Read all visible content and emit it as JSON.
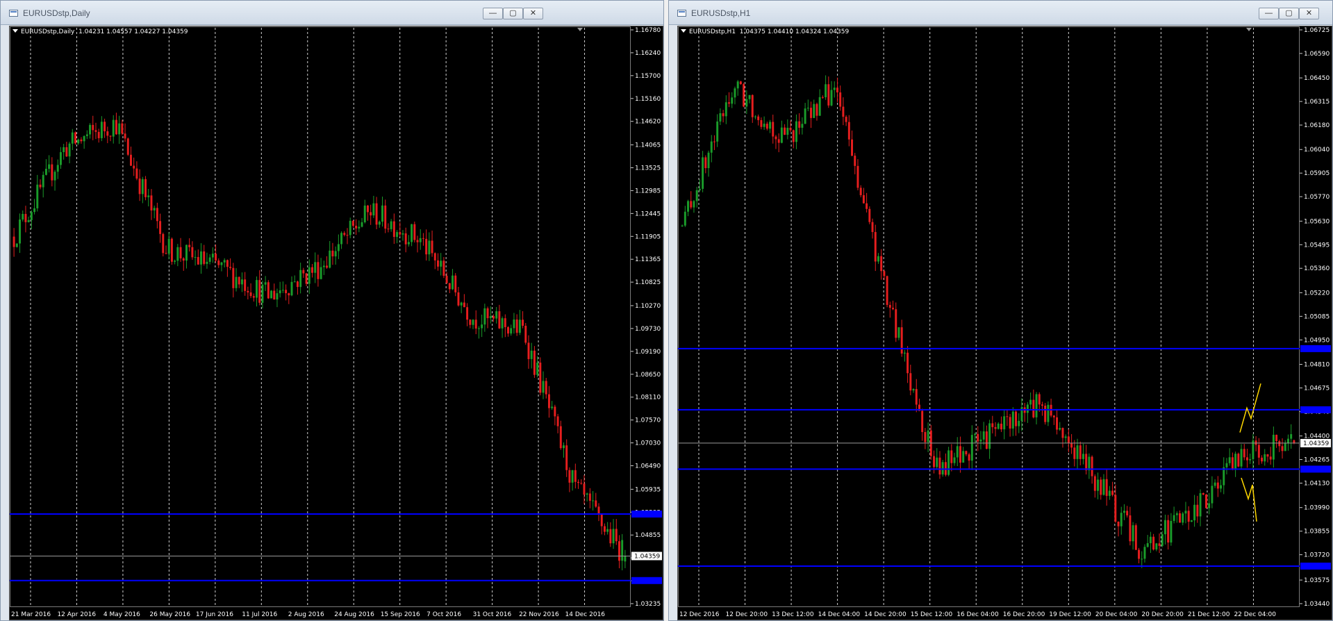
{
  "windows": [
    {
      "id": "daily",
      "title": "EURUSDstp,Daily",
      "symbol": "EURUSDstp,Daily",
      "ohlc": "1.04231 1.04557 1.04227 1.04359",
      "controls": {
        "minimize": "—",
        "maximize": "▢",
        "close": "✕"
      },
      "price_axis": [
        "1.16780",
        "1.16240",
        "1.15700",
        "1.15160",
        "1.14620",
        "1.14065",
        "1.13525",
        "1.12985",
        "1.12445",
        "1.11905",
        "1.11365",
        "1.10825",
        "1.10270",
        "1.09730",
        "1.09190",
        "1.08650",
        "1.08110",
        "1.07570",
        "1.07030",
        "1.06490",
        "1.05935",
        "1.05395",
        "1.04855",
        "1.04315",
        "1.03775",
        "1.03235"
      ],
      "time_axis": [
        "21 Mar 2016",
        "12 Apr 2016",
        "4 May 2016",
        "26 May 2016",
        "17 Jun 2016",
        "11 Jul 2016",
        "2 Aug 2016",
        "24 Aug 2016",
        "15 Sep 2016",
        "7 Oct 2016",
        "31 Oct 2016",
        "22 Nov 2016",
        "14 Dec 2016"
      ],
      "current_price": "1.04359",
      "ymax": 1.1678,
      "ymin": 1.03235,
      "levels": [
        1.0535,
        1.0378
      ],
      "colors": {
        "bull": "#1a9c2a",
        "bear": "#e61e1e",
        "level": "#0000ff",
        "grid": "#d0d0d0",
        "axis_text": "#ffffff"
      },
      "chart_data": {
        "type": "candlestick",
        "timeframe": "Daily",
        "symbol": "EURUSDstp",
        "ylim": [
          1.03235,
          1.1678
        ],
        "x": [
          "21 Mar 2016",
          "12 Apr 2016",
          "4 May 2016",
          "26 May 2016",
          "17 Jun 2016",
          "11 Jul 2016",
          "2 Aug 2016",
          "24 Aug 2016",
          "15 Sep 2016",
          "7 Oct 2016",
          "31 Oct 2016",
          "22 Nov 2016",
          "14 Dec 2016"
        ],
        "close_approx": [
          1.119,
          1.14,
          1.146,
          1.116,
          1.112,
          1.105,
          1.112,
          1.125,
          1.118,
          1.1,
          1.097,
          1.06,
          1.0436
        ],
        "last": {
          "open": 1.04231,
          "high": 1.04557,
          "low": 1.04227,
          "close": 1.04359
        },
        "horizontal_levels": [
          1.0535,
          1.0378
        ],
        "grid": true
      }
    },
    {
      "id": "h1",
      "title": "EURUSDstp,H1",
      "symbol": "EURUSDstp,H1",
      "ohlc": "1.04375 1.04410 1.04324 1.04359",
      "controls": {
        "minimize": "—",
        "maximize": "▢",
        "close": "✕"
      },
      "price_axis": [
        "1.06725",
        "1.06590",
        "1.06450",
        "1.06315",
        "1.06180",
        "1.06040",
        "1.05905",
        "1.05770",
        "1.05630",
        "1.05495",
        "1.05360",
        "1.05220",
        "1.05085",
        "1.04950",
        "1.04810",
        "1.04675",
        "1.04540",
        "1.04400",
        "1.04265",
        "1.04130",
        "1.03990",
        "1.03855",
        "1.03720",
        "1.03575",
        "1.03440"
      ],
      "time_axis": [
        "12 Dec 2016",
        "12 Dec 20:00",
        "13 Dec 12:00",
        "14 Dec 04:00",
        "14 Dec 20:00",
        "15 Dec 12:00",
        "16 Dec 04:00",
        "16 Dec 20:00",
        "19 Dec 12:00",
        "20 Dec 04:00",
        "20 Dec 20:00",
        "21 Dec 12:00",
        "22 Dec 04:00"
      ],
      "current_price": "1.04359",
      "ymax": 1.06725,
      "ymin": 1.0344,
      "levels": [
        1.049,
        1.0455,
        1.0421,
        1.03655
      ],
      "colors": {
        "bull": "#1a9c2a",
        "bear": "#e61e1e",
        "level": "#0000ff",
        "grid": "#d0d0d0",
        "axis_text": "#ffffff",
        "forecast": "#ffd700"
      },
      "chart_data": {
        "type": "candlestick",
        "timeframe": "H1",
        "symbol": "EURUSDstp",
        "ylim": [
          1.0344,
          1.06725
        ],
        "x": [
          "12 Dec 2016",
          "12 Dec 20:00",
          "13 Dec 12:00",
          "14 Dec 04:00",
          "14 Dec 20:00",
          "15 Dec 12:00",
          "16 Dec 04:00",
          "16 Dec 20:00",
          "19 Dec 12:00",
          "20 Dec 04:00",
          "20 Dec 20:00",
          "21 Dec 12:00",
          "22 Dec 04:00"
        ],
        "close_approx": [
          1.056,
          1.064,
          1.061,
          1.064,
          1.052,
          1.042,
          1.044,
          1.046,
          1.042,
          1.0375,
          1.0395,
          1.043,
          1.0436
        ],
        "last": {
          "open": 1.04375,
          "high": 1.0441,
          "low": 1.04324,
          "close": 1.04359
        },
        "horizontal_levels": [
          1.049,
          1.0455,
          1.0421,
          1.03655
        ],
        "grid": true
      }
    }
  ]
}
